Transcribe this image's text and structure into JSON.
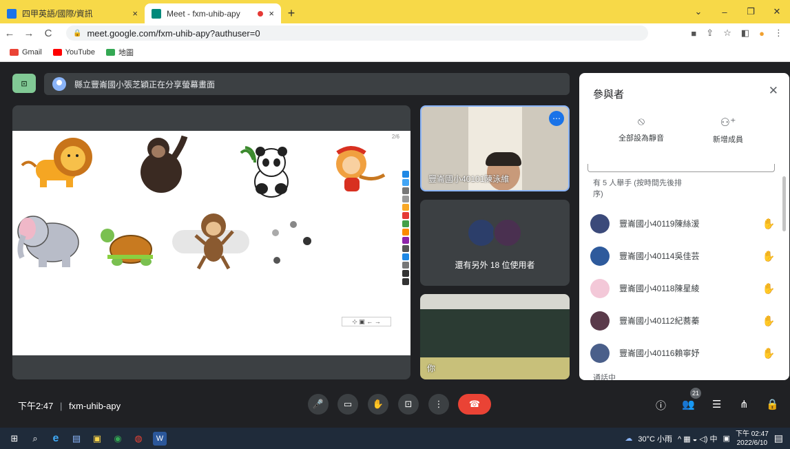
{
  "tabs": [
    {
      "title": "四甲英語/國際/資訊",
      "close": "×",
      "favicon_color": "#1a73e8"
    },
    {
      "title": "Meet - fxm-uhib-apy",
      "close": "×",
      "favicon_color": "#00897b",
      "recording": true
    }
  ],
  "new_tab": "+",
  "window_controls": {
    "dropdown": "⌄",
    "minimize": "–",
    "restore": "❐",
    "close": "✕"
  },
  "address": {
    "url": "meet.google.com/fxm-uhib-apy?authuser=0",
    "lock": "🔒"
  },
  "nav": {
    "back": "←",
    "forward": "→",
    "reload": "C"
  },
  "addr_icons": {
    "cam": "■",
    "share": "⇪",
    "star": "☆",
    "sidepanel": "◧",
    "profile": "●",
    "menu": "⋮"
  },
  "bookmarks": [
    {
      "label": "Gmail",
      "color": "#ea4335"
    },
    {
      "label": "YouTube",
      "color": "#ff0000"
    },
    {
      "label": "地圖",
      "color": "#34a853"
    }
  ],
  "meet": {
    "share_banner": "縣立豐崙國小張芝穎正在分享螢幕畫面",
    "present_icon_label": "⊡",
    "slide_page": "2/6",
    "slide_nav": "⊹ ▣ ← →",
    "tiles": {
      "main_name": "豐崙國小40101陳泳維",
      "more_users": "還有另外 18 位使用者",
      "self_name": "你",
      "menu_dots": "⋯"
    },
    "panel": {
      "title": "參與者",
      "close": "✕",
      "mute_all": "全部設為靜音",
      "add_member": "新增成員",
      "raised_hands_heading": "有 5 人舉手 (按時間先後排序)",
      "participants": [
        {
          "name": "豐崙國小40119陳絲湲",
          "color": "#3b4a7a"
        },
        {
          "name": "豐崙國小40114吳佳芸",
          "color": "#2e5a9c"
        },
        {
          "name": "豐崙國小40118陳星綾",
          "color": "#f3c8d8"
        },
        {
          "name": "豐崙國小40112紀蕎蓁",
          "color": "#5a3a4a"
        },
        {
          "name": "豐崙國小40116賴寧妤",
          "color": "#4a5f8a"
        }
      ],
      "hand_icon": "✋",
      "in_call": "通話中"
    },
    "controls": {
      "time": "下午2:47",
      "separator": "|",
      "meeting_code": "fxm-uhib-apy",
      "mic": "🎤",
      "camera": "▭",
      "raise_hand": "✋",
      "present": "⊡",
      "more": "⋮",
      "end_call": "☎",
      "info": "ⓘ",
      "people": "👥",
      "people_count": "21",
      "chat": "☰",
      "activities": "⋔",
      "host_controls": "🔒"
    }
  },
  "taskbar": {
    "start": "⊞",
    "search": "⌕",
    "apps": [
      "e",
      "▤",
      "▣",
      "◉",
      "◍",
      "W"
    ],
    "weather": "30°C 小雨",
    "tray_symbols": "^ ▦ ◒ ◁) 中",
    "time": "下午 02:47",
    "date": "2022/6/10",
    "notify": "▤"
  }
}
